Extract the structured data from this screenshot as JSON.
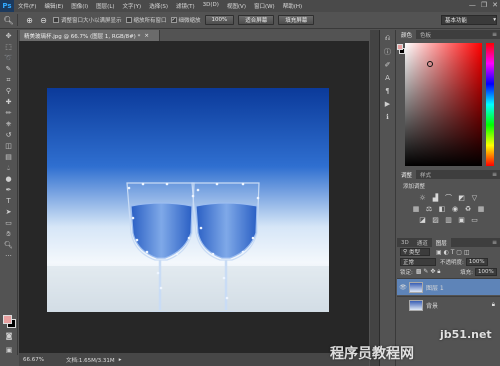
{
  "app": {
    "logo": "Ps"
  },
  "menu": [
    "文件(F)",
    "编辑(E)",
    "图像(I)",
    "图层(L)",
    "文字(Y)",
    "选择(S)",
    "滤镜(T)",
    "3D(D)",
    "视图(V)",
    "窗口(W)",
    "帮助(H)"
  ],
  "window_controls": {
    "minimize": "—",
    "restore": "❐",
    "close": "✕"
  },
  "options_bar": {
    "resize_windows_label": "调整窗口大小以满屏显示",
    "zoom_all_label": "缩放所有窗口",
    "scrubby_zoom_label": "细微缩放",
    "btn_100": "100%",
    "btn_fit": "适合屏幕",
    "btn_fill": "填充屏幕",
    "workspace": "基本功能"
  },
  "document": {
    "tab_title": "精美玻璃杯.jpg @ 66.7% (图层 1, RGB/8#) *",
    "tab_close": "×"
  },
  "status": {
    "zoom": "66.67%",
    "doc_size": "文档:1.65M/3.31M"
  },
  "color_panel": {
    "tab_color": "颜色",
    "tab_swatches": "色板",
    "fg_color": "#e8a0a0",
    "bg_color": "#000000"
  },
  "adjustments_panel": {
    "tab_adjustments": "调整",
    "tab_styles": "样式",
    "title": "添加调整"
  },
  "layers_panel": {
    "tab_3d": "3D",
    "tab_channels": "通道",
    "tab_layers": "图层",
    "filter_kind": "类型",
    "blend_mode": "正常",
    "opacity_label": "不透明度:",
    "opacity_value": "100%",
    "lock_label": "锁定:",
    "fill_label": "填充:",
    "fill_value": "100%",
    "layers": [
      {
        "name": "图层 1",
        "selected": true
      },
      {
        "name": "背景",
        "selected": false
      }
    ]
  },
  "watermarks": {
    "site": "jb51.net",
    "brand": "程序员教程网"
  },
  "colors": {
    "ui_bg": "#535353",
    "canvas_bg": "#272727",
    "selected_layer": "#5e84b8",
    "ps_blue": "#31a8ff"
  }
}
